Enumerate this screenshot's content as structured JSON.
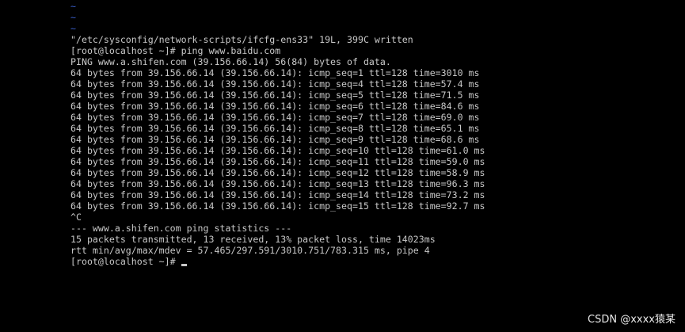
{
  "terminal": {
    "lines": [
      {
        "text": "~",
        "kind": "tilde"
      },
      {
        "text": "~",
        "kind": "tilde"
      },
      {
        "text": "~",
        "kind": "tilde"
      },
      {
        "text": "\"/etc/sysconfig/network-scripts/ifcfg-ens33\" 19L, 399C written",
        "kind": "output"
      },
      {
        "text": "[root@localhost ~]# ping www.baidu.com",
        "kind": "command"
      },
      {
        "text": "PING www.a.shifen.com (39.156.66.14) 56(84) bytes of data.",
        "kind": "output"
      },
      {
        "text": "64 bytes from 39.156.66.14 (39.156.66.14): icmp_seq=1 ttl=128 time=3010 ms",
        "kind": "output"
      },
      {
        "text": "64 bytes from 39.156.66.14 (39.156.66.14): icmp_seq=4 ttl=128 time=57.4 ms",
        "kind": "output"
      },
      {
        "text": "64 bytes from 39.156.66.14 (39.156.66.14): icmp_seq=5 ttl=128 time=71.5 ms",
        "kind": "output"
      },
      {
        "text": "64 bytes from 39.156.66.14 (39.156.66.14): icmp_seq=6 ttl=128 time=84.6 ms",
        "kind": "output"
      },
      {
        "text": "64 bytes from 39.156.66.14 (39.156.66.14): icmp_seq=7 ttl=128 time=69.0 ms",
        "kind": "output"
      },
      {
        "text": "64 bytes from 39.156.66.14 (39.156.66.14): icmp_seq=8 ttl=128 time=65.1 ms",
        "kind": "output"
      },
      {
        "text": "64 bytes from 39.156.66.14 (39.156.66.14): icmp_seq=9 ttl=128 time=68.6 ms",
        "kind": "output"
      },
      {
        "text": "64 bytes from 39.156.66.14 (39.156.66.14): icmp_seq=10 ttl=128 time=61.0 ms",
        "kind": "output"
      },
      {
        "text": "64 bytes from 39.156.66.14 (39.156.66.14): icmp_seq=11 ttl=128 time=59.0 ms",
        "kind": "output"
      },
      {
        "text": "64 bytes from 39.156.66.14 (39.156.66.14): icmp_seq=12 ttl=128 time=58.9 ms",
        "kind": "output"
      },
      {
        "text": "64 bytes from 39.156.66.14 (39.156.66.14): icmp_seq=13 ttl=128 time=96.3 ms",
        "kind": "output"
      },
      {
        "text": "64 bytes from 39.156.66.14 (39.156.66.14): icmp_seq=14 ttl=128 time=73.2 ms",
        "kind": "output"
      },
      {
        "text": "64 bytes from 39.156.66.14 (39.156.66.14): icmp_seq=15 ttl=128 time=92.7 ms",
        "kind": "output"
      },
      {
        "text": "^C",
        "kind": "output"
      },
      {
        "text": "--- www.a.shifen.com ping statistics ---",
        "kind": "output"
      },
      {
        "text": "15 packets transmitted, 13 received, 13% packet loss, time 14023ms",
        "kind": "output"
      },
      {
        "text": "rtt min/avg/max/mdev = 57.465/297.591/3010.751/783.315 ms, pipe 4",
        "kind": "output"
      },
      {
        "text": "[root@localhost ~]# ",
        "kind": "prompt"
      }
    ]
  },
  "watermark": "CSDN @xxxx猿某",
  "colors": {
    "background": "#000000",
    "text": "#c8c8c8",
    "tilde": "#3a5fcd"
  }
}
